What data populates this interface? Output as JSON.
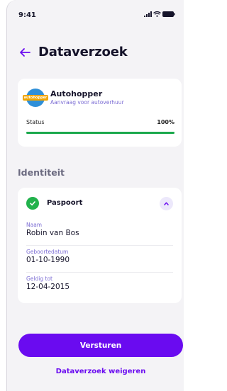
{
  "status_bar": {
    "time": "9:41"
  },
  "header": {
    "title": "Dataverzoek"
  },
  "request": {
    "logo_text": "autohopper",
    "org_name": "Autohopper",
    "org_subtitle": "Aanvraag voor autoverhuur",
    "status_label": "Status",
    "status_value": "100%",
    "progress": 1.0
  },
  "identity": {
    "section_title": "Identiteit",
    "document_name": "Paspoort",
    "fields": [
      {
        "label": "Naam",
        "value": "Robin van Bos"
      },
      {
        "label": "Geboortedatum",
        "value": "01-10-1990"
      },
      {
        "label": "Geldig tot",
        "value": "12-04-2015"
      }
    ]
  },
  "actions": {
    "submit_label": "Versturen",
    "decline_label": "Dataverzoek weigeren"
  },
  "colors": {
    "accent": "#6a0bf0",
    "success": "#22b24c",
    "label": "#7c6dd4"
  }
}
